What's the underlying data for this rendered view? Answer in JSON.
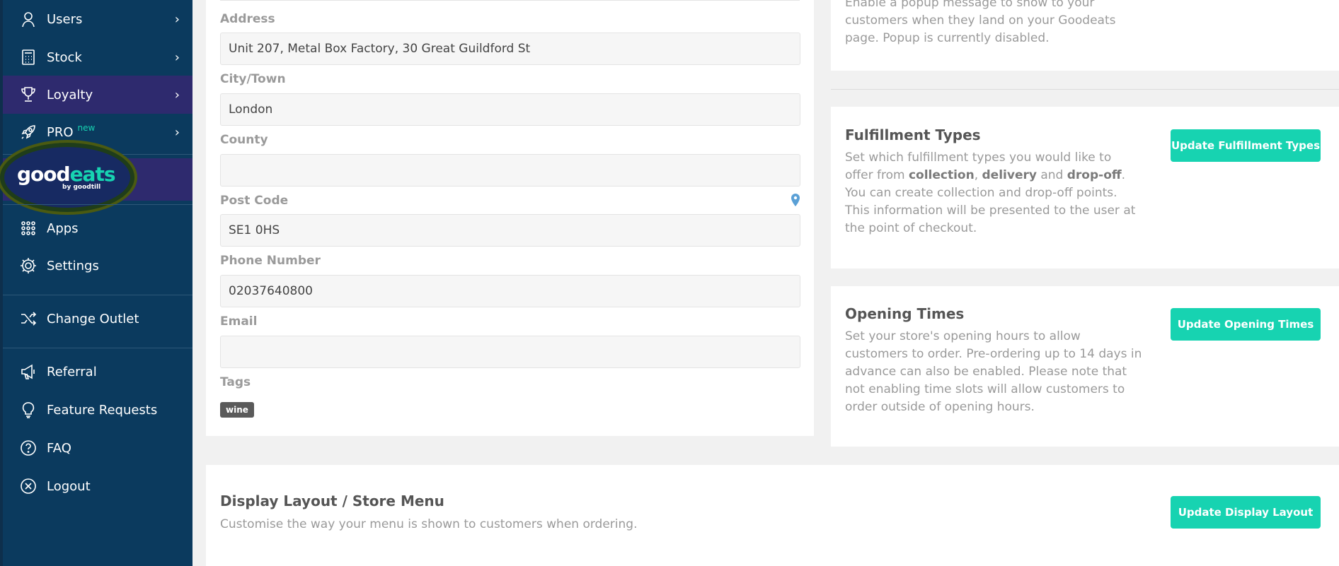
{
  "sidebar": {
    "items": [
      {
        "label": "Users",
        "icon": "user-icon"
      },
      {
        "label": "Stock",
        "icon": "calculator-icon"
      },
      {
        "label": "Loyalty",
        "icon": "trophy-icon"
      },
      {
        "label": "PRO",
        "badge": "new",
        "icon": "rocket-icon"
      },
      {
        "label": "Apps",
        "icon": "grid-icon"
      },
      {
        "label": "Settings",
        "icon": "gear-icon"
      },
      {
        "label": "Change Outlet",
        "icon": "shuffle-icon"
      },
      {
        "label": "Referral",
        "icon": "megaphone-icon"
      },
      {
        "label": "Feature Requests",
        "icon": "lightbulb-icon"
      },
      {
        "label": "FAQ",
        "icon": "question-icon"
      },
      {
        "label": "Logout",
        "icon": "close-circle-icon"
      }
    ],
    "logo": {
      "good": "good",
      "eats": "eats",
      "sub": "by goodtill"
    }
  },
  "form": {
    "address_label": "Address",
    "address_value": "Unit 207, Metal Box Factory, 30 Great Guildford St",
    "city_label": "City/Town",
    "city_value": "London",
    "county_label": "County",
    "county_value": "",
    "postcode_label": "Post Code",
    "postcode_value": "SE1 0HS",
    "phone_label": "Phone Number",
    "phone_value": "02037640800",
    "email_label": "Email",
    "email_value": "",
    "tags_label": "Tags",
    "tags": [
      "wine"
    ]
  },
  "popup_card": {
    "desc_line1": "Enable a popup message to show to your",
    "desc_line2": "customers when they land on your Goodeats",
    "desc_line3": "page. Popup is currently disabled."
  },
  "fulfillment": {
    "title": "Fulfillment Types",
    "desc_pre": "Set which fulfillment types you would like to offer from ",
    "collection": "collection",
    "comma": ", ",
    "delivery": "delivery",
    "and": " and ",
    "dropoff": "drop-off",
    "desc_post": ". You can create collection and drop-off points. This information will be presented to the user at the point of checkout.",
    "button": "Update Fulfillment Types"
  },
  "opening": {
    "title": "Opening Times",
    "desc": "Set your store's opening hours to allow customers to order. Pre-ordering up to 14 days in advance can also be enabled. Please note that not enabling time slots will allow customers to order outside of opening hours.",
    "button": "Update Opening Times"
  },
  "display_layout": {
    "title": "Display Layout / Store Menu",
    "desc": "Customise the way your menu is shown to customers when ordering.",
    "button": "Update Display Layout"
  },
  "colors": {
    "sidebar_bg": "#0b3a5e",
    "active_bg": "#2e2a6e",
    "accent": "#17d3b1"
  }
}
